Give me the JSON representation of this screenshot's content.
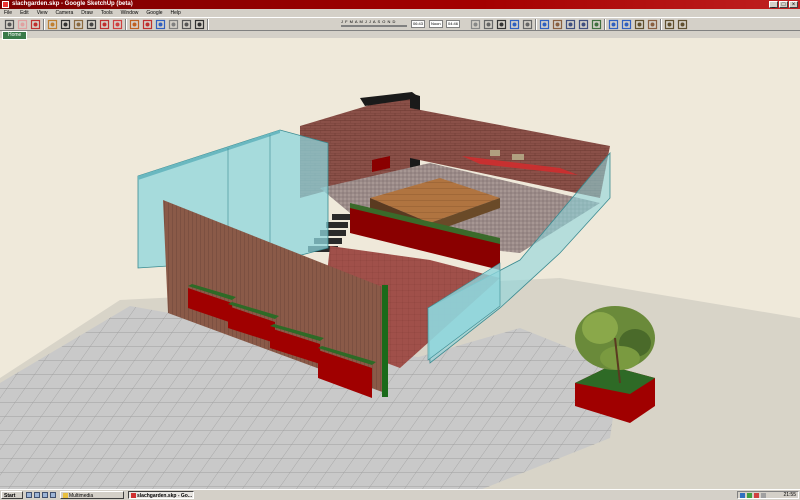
{
  "window": {
    "title": "slachgarden.skp - Google SketchUp (beta)",
    "controls": [
      "_",
      "□",
      "×"
    ]
  },
  "menu": [
    "File",
    "Edit",
    "View",
    "Camera",
    "Draw",
    "Tools",
    "Window",
    "Google",
    "Help"
  ],
  "toolbar": {
    "tools": [
      "select-icon",
      "eraser-icon",
      "pencil-icon",
      "paint-bucket-icon",
      "line-icon",
      "rectangle-icon",
      "circle-icon",
      "arc-icon",
      "move-icon",
      "push-pull-icon",
      "rotate-icon",
      "follow-me-icon",
      "scale-icon",
      "offset-icon",
      "tape-measure-icon",
      "dimension-icon",
      "protractor-icon",
      "text-icon",
      "axes-icon",
      "3d-text-icon",
      "orbit-icon",
      "pan-icon",
      "zoom-icon",
      "zoom-window-icon",
      "zoom-extents-icon",
      "previous-view-icon",
      "next-view-icon",
      "position-camera-icon",
      "walk-icon",
      "look-around-icon",
      "section-icon"
    ],
    "shadow": {
      "months": "J F M A M J J A S O N D",
      "time_start": "06:43",
      "time_noon": "Noon",
      "time_end": "04:46"
    }
  },
  "scene_tab": "Home",
  "colors": {
    "ground": "#c8c8c8",
    "glass": "#8ed6dc",
    "brick": "#8a5048",
    "planter": "#8a0000",
    "deck": "#a46a3c"
  },
  "taskbar": {
    "start": "Start",
    "tasks": [
      {
        "label": "Multimedia",
        "active": false
      },
      {
        "label": "slachgarden.skp - Go...",
        "active": true
      }
    ],
    "clock": "21:55"
  }
}
